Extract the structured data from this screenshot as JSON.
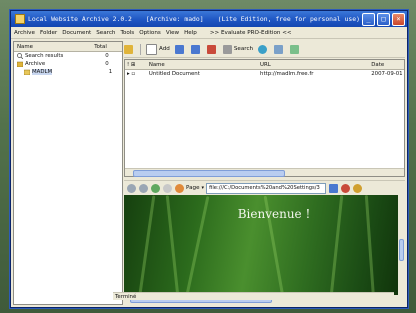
{
  "window": {
    "title_app": "Local Website Archive 2.0.2",
    "title_archive": "[Archive: mado]",
    "title_edition": "(Lite Edition, free for personal use)"
  },
  "menu": {
    "items": [
      "Archive",
      "Folder",
      "Document",
      "Search",
      "Tools",
      "Options",
      "View",
      "Help"
    ],
    "promo": ">> Evaluate PRO-Edition <<"
  },
  "tree": {
    "col_name": "Name",
    "col_total": "Total",
    "rows": [
      {
        "name": "Search results",
        "total": "0"
      },
      {
        "name": "Archive",
        "total": "0"
      },
      {
        "name": "MADLM",
        "total": "1"
      }
    ]
  },
  "toolbar": {
    "add_label": "Add",
    "search_label": "Search"
  },
  "documents": {
    "headers": {
      "flags": "",
      "name": "Name",
      "url": "URL",
      "date": "Date"
    },
    "rows": [
      {
        "name": "Untitled Document",
        "url": "http://madlm.free.fr",
        "date": "2007-09-01"
      }
    ]
  },
  "browser": {
    "page_label": "Page",
    "address": "file:///C:/Documents%20and%20Settings/3",
    "heading": "Bienvenue !"
  },
  "status": {
    "text": "Terminé"
  },
  "colors": {
    "titlebar": "#1f56c3",
    "selection": "#c8d6ef",
    "grass": "#2b6a1c"
  }
}
